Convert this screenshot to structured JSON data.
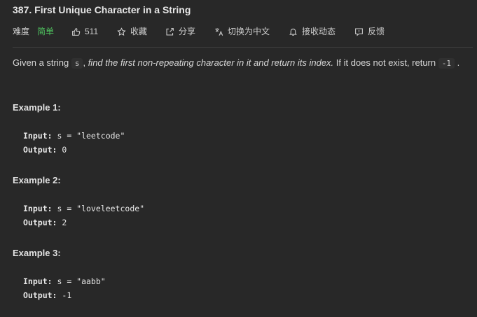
{
  "problem": {
    "title": "387. First Unique Character in a String",
    "difficulty_label": "难度",
    "difficulty": "简单",
    "likes": "511",
    "favorite": "收藏",
    "share": "分享",
    "translate": "切换为中文",
    "subscribe": "接收动态",
    "feedback": "反馈"
  },
  "description": {
    "part1": "Given a string",
    "code1": "s",
    "part2": ", ",
    "italic": "find the first non-repeating character in it and return its index.",
    "part3": " If it does not exist, return",
    "code2": "-1",
    "part4": "."
  },
  "examples": [
    {
      "heading": "Example 1:",
      "input_label": "Input:",
      "input": " s = \"leetcode\"",
      "output_label": "Output:",
      "output": " 0"
    },
    {
      "heading": "Example 2:",
      "input_label": "Input:",
      "input": " s = \"loveleetcode\"",
      "output_label": "Output:",
      "output": " 2"
    },
    {
      "heading": "Example 3:",
      "input_label": "Input:",
      "input": " s = \"aabb\"",
      "output_label": "Output:",
      "output": " -1"
    }
  ],
  "colors": {
    "background": "#282828",
    "easy": "#4fc25f"
  }
}
